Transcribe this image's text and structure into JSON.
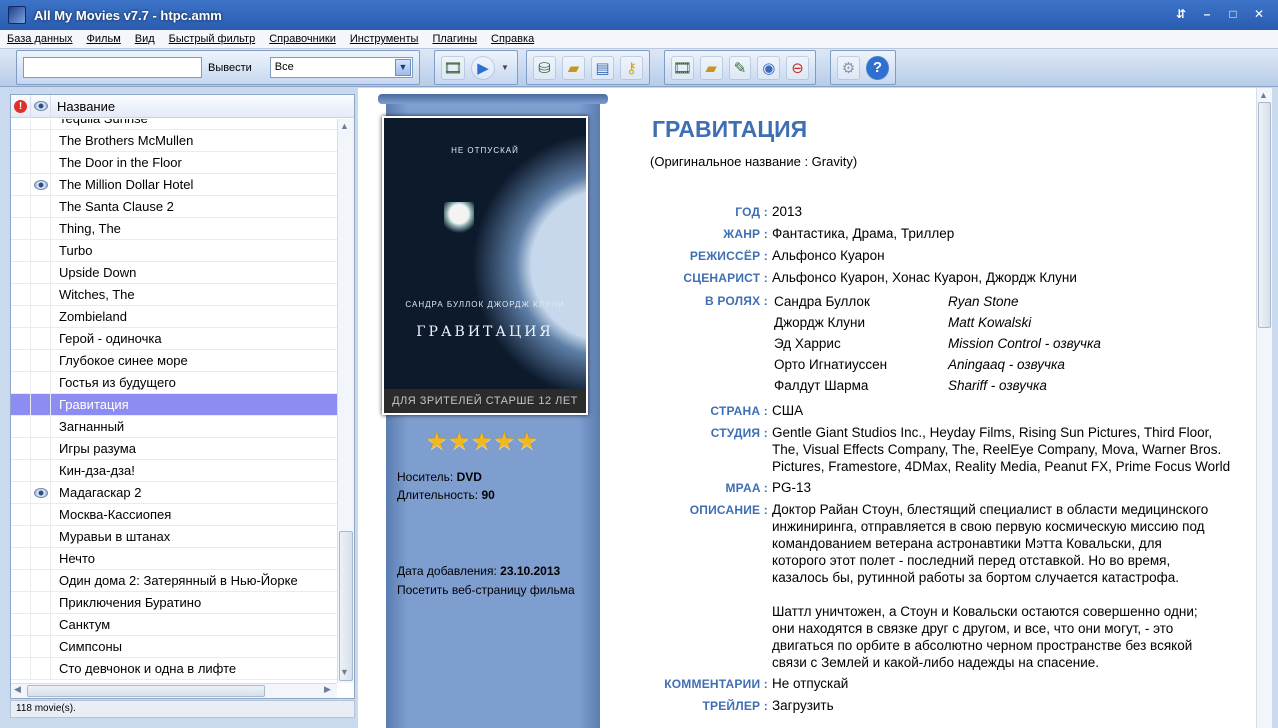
{
  "window": {
    "title": "All My Movies v7.7 - htpc.amm"
  },
  "menu": [
    "База данных",
    "Фильм",
    "Вид",
    "Быстрый фильтр",
    "Справочники",
    "Инструменты",
    "Плагины",
    "Справка"
  ],
  "toolbar": {
    "search_value": "",
    "show_label": "Вывести",
    "filter_value": "Все"
  },
  "list": {
    "header_title": "Название",
    "items": [
      {
        "title": "Tequila Sunrise",
        "seen": false
      },
      {
        "title": "The Brothers McMullen",
        "seen": false
      },
      {
        "title": "The Door in the Floor",
        "seen": false
      },
      {
        "title": "The Million Dollar Hotel",
        "seen": true
      },
      {
        "title": "The Santa Clause 2",
        "seen": false
      },
      {
        "title": "Thing, The",
        "seen": false
      },
      {
        "title": "Turbo",
        "seen": false
      },
      {
        "title": "Upside Down",
        "seen": false
      },
      {
        "title": "Witches, The",
        "seen": false
      },
      {
        "title": "Zombieland",
        "seen": false
      },
      {
        "title": "Герой - одиночка",
        "seen": false
      },
      {
        "title": "Глубокое синее море",
        "seen": false
      },
      {
        "title": "Гостья из будущего",
        "seen": false
      },
      {
        "title": "Гравитация",
        "seen": false,
        "selected": true
      },
      {
        "title": "Загнанный",
        "seen": false
      },
      {
        "title": "Игры разума",
        "seen": false
      },
      {
        "title": "Кин-дза-дза!",
        "seen": false
      },
      {
        "title": "Мадагаскар 2",
        "seen": true
      },
      {
        "title": "Москва-Кассиопея",
        "seen": false
      },
      {
        "title": "Муравьи в штанах",
        "seen": false
      },
      {
        "title": "Нечто",
        "seen": false
      },
      {
        "title": "Один дома 2: Затерянный в Нью-Йорке",
        "seen": false
      },
      {
        "title": "Приключения Буратино",
        "seen": false
      },
      {
        "title": "Санктум",
        "seen": false
      },
      {
        "title": "Симпсоны",
        "seen": false
      },
      {
        "title": "Сто девчонок и одна в лифте",
        "seen": false
      }
    ],
    "status": "118 movie(s)."
  },
  "poster": {
    "top_text": "НЕ ОТПУСКАЙ",
    "actors_text": "САНДРА БУЛЛОК   ДЖОРДЖ КЛУНИ",
    "title": "ГРАВИТАЦИЯ",
    "age_text": "ДЛЯ ЗРИТЕЛЕЙ СТАРШЕ 12 ЛЕТ",
    "rating": 5
  },
  "details": {
    "title": "ГРАВИТАЦИЯ",
    "original": "(Оригинальное название : Gravity)",
    "media_label": "Носитель:",
    "media_value": "DVD",
    "duration_label": "Длительность:",
    "duration_value": "90",
    "added_label": "Дата добавления:",
    "added_value": "23.10.2013",
    "visit_link": "Посетить веб-страницу фильма",
    "year_label": "ГОД :",
    "year": "2013",
    "genre_label": "ЖАНР :",
    "genre": "Фантастика, Драма, Триллер",
    "director_label": "РЕЖИССЁР :",
    "director": "Альфонсо Куарон",
    "writer_label": "СЦЕНАРИСТ :",
    "writer": "Альфонсо Куарон, Хонас Куарон, Джордж Клуни",
    "cast_label": "В РОЛЯХ :",
    "cast": [
      {
        "actor": "Сандра Буллок",
        "role": "Ryan Stone"
      },
      {
        "actor": "Джордж Клуни",
        "role": "Matt Kowalski"
      },
      {
        "actor": "Эд Харрис",
        "role": "Mission Control - озвучка"
      },
      {
        "actor": "Орто Игнатиуссен",
        "role": "Aningaaq - озвучка"
      },
      {
        "actor": "Фалдут Шарма",
        "role": "Shariff - озвучка"
      }
    ],
    "country_label": "СТРАНА :",
    "country": "США",
    "studio_label": "СТУДИЯ :",
    "studio_lines": [
      "Gentle Giant Studios Inc., Heyday Films, Rising Sun Pictures, Third Floor,",
      "The, Visual Effects Company, The, ReelEye Company, Mova, Warner Bros.",
      "Pictures, Framestore, 4DMax, Reality Media, Peanut FX, Prime Focus World"
    ],
    "mpaa_label": "MPAA :",
    "mpaa": "PG-13",
    "desc_label": "ОПИСАНИЕ :",
    "desc_lines": [
      "Доктор Райан Стоун, блестящий специалист в области медицинского",
      "инжиниринга, отправляется в свою первую космическую миссию под",
      "командованием ветерана астронавтики Мэтта Ковальски, для",
      "которого этот полет - последний перед отставкой. Но во время,",
      "казалось бы, рутинной работы за бортом случается катастрофа.",
      "",
      "Шаттл уничтожен, а Стоун и Ковальски остаются совершенно одни;",
      "они находятся в связке друг с другом, и все, что они могут, - это",
      "двигаться по орбите в абсолютно черном пространстве без всякой",
      "связи с Землей и какой-либо надежды на спасение."
    ],
    "comments_label": "КОММЕНТАРИИ :",
    "comments": "Не отпускай",
    "trailer_label": "ТРЕЙЛЕР :",
    "trailer": "Загрузить"
  }
}
